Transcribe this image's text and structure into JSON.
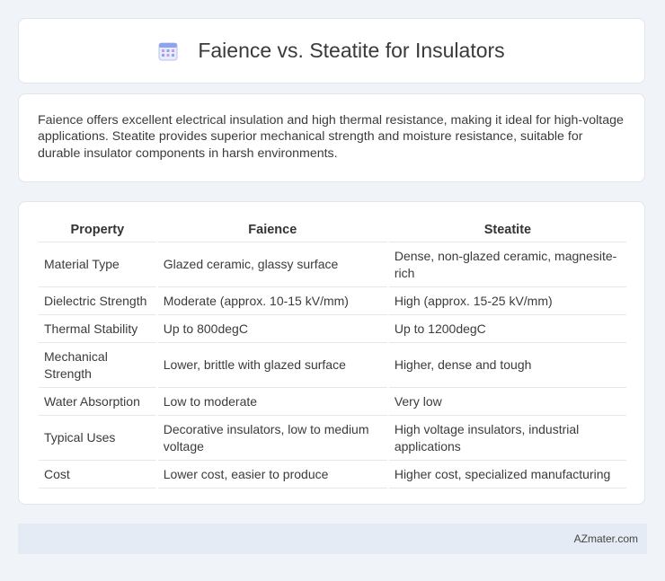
{
  "header": {
    "title": "Faience vs. Steatite for Insulators",
    "icon": "table-calendar-icon"
  },
  "summary": {
    "text": "Faience offers excellent electrical insulation and high thermal resistance, making it ideal for high-voltage applications. Steatite provides superior mechanical strength and moisture resistance, suitable for durable insulator components in harsh environments."
  },
  "table": {
    "headers": [
      "Property",
      "Faience",
      "Steatite"
    ],
    "rows": [
      [
        "Material Type",
        "Glazed ceramic, glassy surface",
        "Dense, non-glazed ceramic, magnesite-rich"
      ],
      [
        "Dielectric Strength",
        "Moderate (approx. 10-15 kV/mm)",
        "High (approx. 15-25 kV/mm)"
      ],
      [
        "Thermal Stability",
        "Up to 800degC",
        "Up to 1200degC"
      ],
      [
        "Mechanical Strength",
        "Lower, brittle with glazed surface",
        "Higher, dense and tough"
      ],
      [
        "Water Absorption",
        "Low to moderate",
        "Very low"
      ],
      [
        "Typical Uses",
        "Decorative insulators, low to medium voltage",
        "High voltage insulators, industrial applications"
      ],
      [
        "Cost",
        "Lower cost, easier to produce",
        "Higher cost, specialized manufacturing"
      ]
    ]
  },
  "footer": {
    "text": "AZmater.com"
  },
  "colors": {
    "background": "#f0f3f8",
    "card": "#ffffff",
    "footer_bar": "#e5ebf5",
    "icon_accent": "#7b8fe0"
  }
}
